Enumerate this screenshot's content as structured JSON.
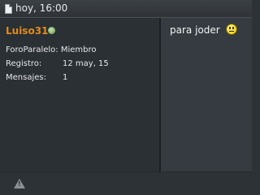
{
  "post": {
    "timestamp": "hoy, 16:00",
    "text": "para joder"
  },
  "user": {
    "name": "Luiso31",
    "role": "ForoParalelo: Miembro",
    "registro_label": "Registro:",
    "registro_value": "12 may, 15",
    "mensajes_label": "Mensajes:",
    "mensajes_value": "1",
    "status": "online"
  },
  "icons": {
    "header": "document-icon",
    "status": "online-status-icon",
    "smiley": "smiley-icon",
    "footer": "warning-icon"
  },
  "colors": {
    "username": "#e08a1e",
    "background": "#2d3236"
  }
}
